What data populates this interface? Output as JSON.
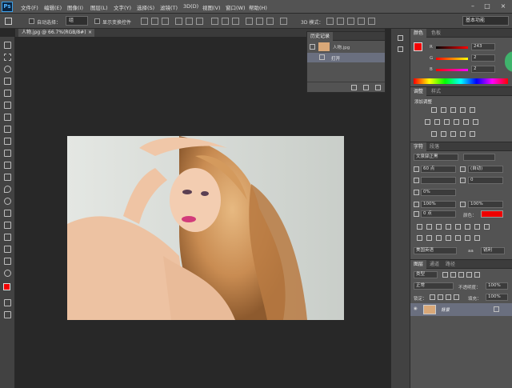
{
  "menu": {
    "logo": "Ps",
    "items": [
      "文件(F)",
      "编辑(E)",
      "图像(I)",
      "图层(L)",
      "文字(Y)",
      "选择(S)",
      "滤镜(T)",
      "3D(D)",
      "视图(V)",
      "窗口(W)",
      "帮助(H)"
    ],
    "minimize": "–",
    "maximize": "□",
    "close": "×"
  },
  "options": {
    "auto_select_label": "自动选择：",
    "auto_select_value": "组",
    "show_transform_label": "显示变换控件",
    "mode_3d_label": "3D 模式：",
    "workspace": "基本功能"
  },
  "document": {
    "tab_title": "人物.jpg @ 66.7%(RGB/8#)",
    "close": "×"
  },
  "history": {
    "tabs": [
      "历史记录"
    ],
    "items": [
      {
        "label": "人物.jpg"
      },
      {
        "label": "打开"
      }
    ]
  },
  "color": {
    "tabs": [
      "颜色",
      "色板"
    ],
    "r_label": "R",
    "g_label": "G",
    "b_label": "B",
    "r": "243",
    "g": "2",
    "b": "2",
    "fg_color": "#f30202"
  },
  "adjustments": {
    "tabs": [
      "调整",
      "样式"
    ],
    "title": "添加调整"
  },
  "character": {
    "tabs": [
      "字符",
      "段落"
    ],
    "font": "文泉驿正黑",
    "size": "60 点",
    "leading": "(自动)",
    "kerning": "0",
    "tracking": "0%",
    "vscale": "100%",
    "hscale": "100%",
    "baseline": "0 点",
    "color_label": "颜色：",
    "color": "#ee0000",
    "language": "美国英语",
    "aa": "锐利"
  },
  "layers": {
    "tabs": [
      "图层",
      "通道",
      "路径"
    ],
    "kind": "类型",
    "blend": "正常",
    "opacity_label": "不透明度：",
    "opacity": "100%",
    "lock_label": "锁定：",
    "fill_label": "填充：",
    "fill": "100%",
    "items": [
      {
        "name": "背景"
      }
    ]
  }
}
